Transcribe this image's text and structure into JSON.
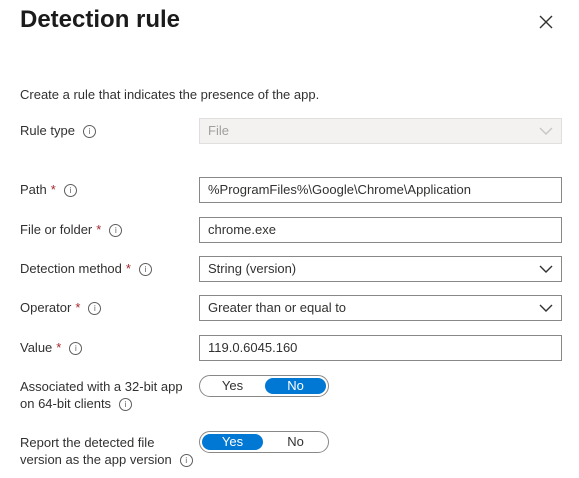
{
  "panel": {
    "title": "Detection rule",
    "description": "Create a rule that indicates the presence of the app."
  },
  "icons": {
    "close": "close-icon",
    "info": "info-icon",
    "chevron": "chevron-down-icon"
  },
  "colors": {
    "accent": "#0078d4",
    "required": "#a4262c"
  },
  "form": {
    "rule_type": {
      "label": "Rule type",
      "value": "File"
    },
    "path": {
      "label": "Path",
      "value": "%ProgramFiles%\\Google\\Chrome\\Application"
    },
    "file_or_folder": {
      "label": "File or folder",
      "value": "chrome.exe"
    },
    "detection_method": {
      "label": "Detection method",
      "value": "String (version)"
    },
    "operator": {
      "label": "Operator",
      "value": "Greater than or equal to"
    },
    "value": {
      "label": "Value",
      "value": "119.0.6045.160"
    },
    "associated_32bit": {
      "label_line1": "Associated with a 32-bit app",
      "label_line2": "on 64-bit clients",
      "options": [
        "Yes",
        "No"
      ],
      "selected": "No"
    },
    "report_version": {
      "label_line1": "Report the detected file",
      "label_line2": "version as the app version",
      "options": [
        "Yes",
        "No"
      ],
      "selected": "Yes"
    },
    "required_marker": "*",
    "info_glyph": "i"
  }
}
